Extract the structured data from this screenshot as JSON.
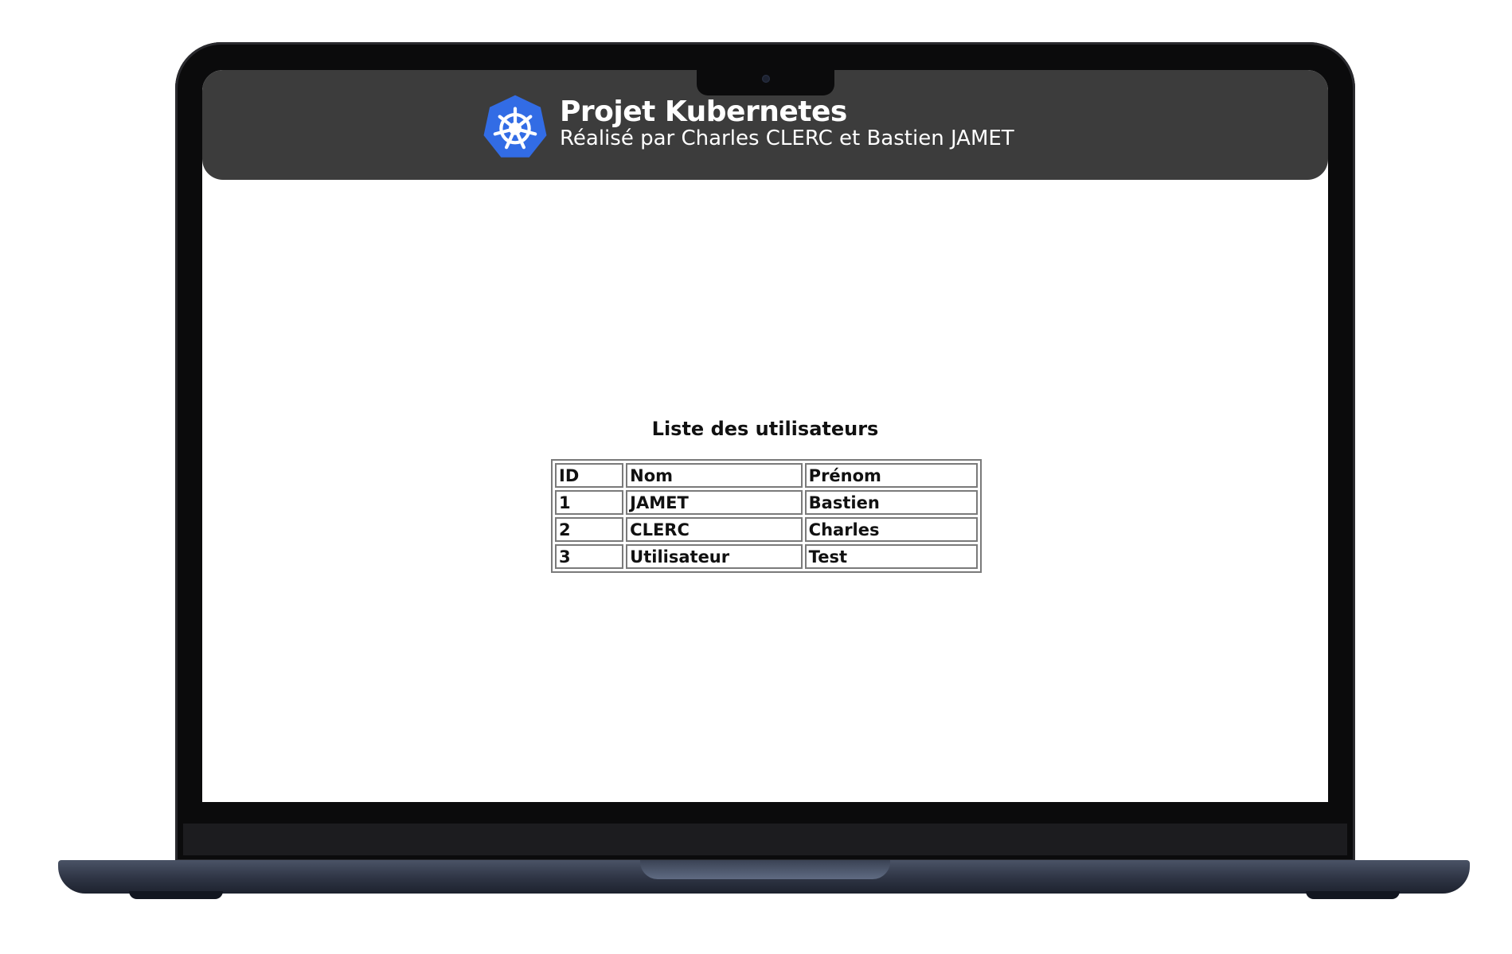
{
  "header": {
    "title": "Projet Kubernetes",
    "subtitle": "Réalisé par Charles CLERC et Bastien JAMET",
    "logo_icon": "kubernetes-helm-icon",
    "colors": {
      "header_bg": "#3c3c3c",
      "logo_blue": "#326ce5"
    }
  },
  "main": {
    "title": "Liste des utilisateurs",
    "table": {
      "columns": [
        "ID",
        "Nom",
        "Prénom"
      ],
      "rows": [
        [
          "1",
          "JAMET",
          "Bastien"
        ],
        [
          "2",
          "CLERC",
          "Charles"
        ],
        [
          "3",
          "Utilisateur",
          "Test"
        ]
      ]
    }
  }
}
